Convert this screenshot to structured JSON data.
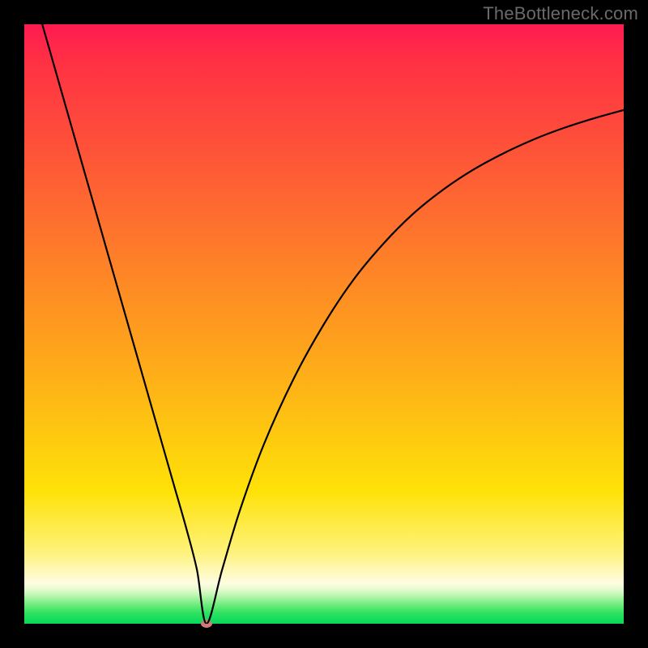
{
  "watermark": "TheBottleneck.com",
  "colors": {
    "frame_background": "#000000",
    "watermark_text": "#6a6a6a",
    "curve_stroke": "#000000",
    "marker_fill": "#cc7b79",
    "gradient_stops": [
      "#ff1a52",
      "#ff3044",
      "#fe5a36",
      "#fe8626",
      "#feb217",
      "#fee208",
      "#fef27a",
      "#fefce0",
      "#e8fbd2",
      "#bff7b3",
      "#8ef090",
      "#5ee974",
      "#2fe260",
      "#06d95a"
    ]
  },
  "chart_data": {
    "type": "line",
    "title": "",
    "xlabel": "",
    "ylabel": "",
    "xlim": [
      0,
      100
    ],
    "ylim": [
      0,
      100
    ],
    "annotations": [],
    "series": [
      {
        "name": "bottleneck-curve",
        "x": [
          3,
          5,
          8,
          11,
          14,
          17,
          20,
          23,
          25,
          27,
          28.8,
          30.4,
          33,
          36,
          40,
          45,
          50,
          55,
          60,
          65,
          70,
          75,
          80,
          85,
          90,
          95,
          100
        ],
        "values": [
          100,
          93,
          82.5,
          72,
          61.5,
          51,
          40.5,
          30,
          23,
          16,
          9,
          0,
          9,
          19,
          30,
          41,
          50,
          57.5,
          63.5,
          68.5,
          72.5,
          75.8,
          78.5,
          80.8,
          82.7,
          84.3,
          85.7
        ]
      }
    ],
    "marker": {
      "x": 30.4,
      "y": 0
    }
  }
}
